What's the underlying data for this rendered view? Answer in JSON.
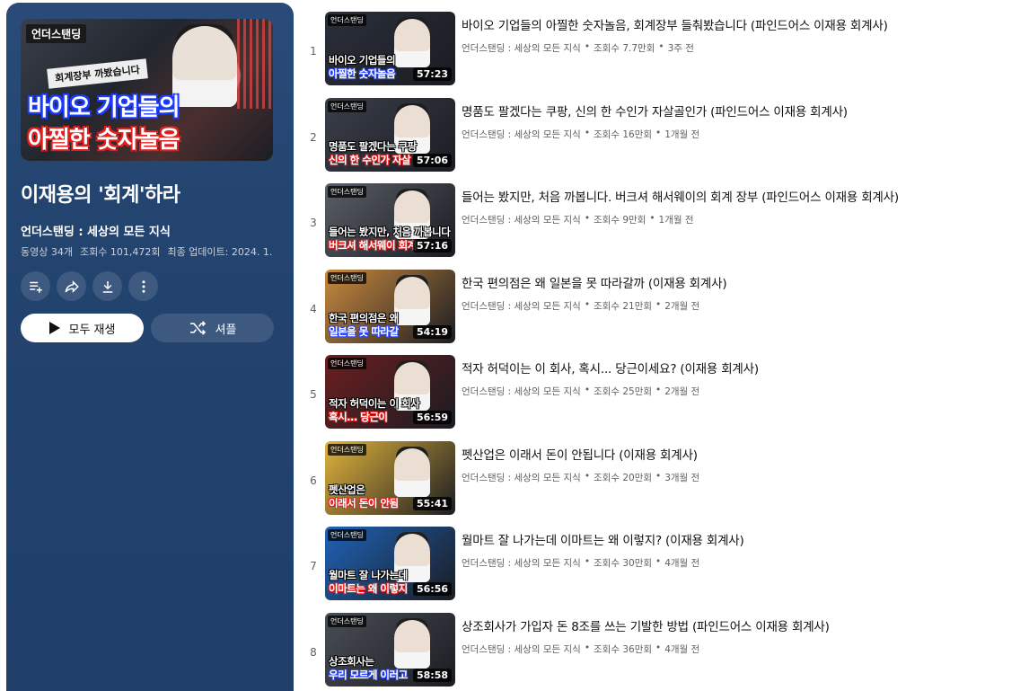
{
  "playlist": {
    "thumbnail": {
      "channel_tag": "언더스탠딩",
      "caption_small": "회계장부 까봤습니다",
      "caption_line1": "바이오 기업들의",
      "caption_line2": "아찔한 숫자놀음"
    },
    "title": "이재용의 '회계'하라",
    "channel": "언더스탠딩 : 세상의 모든 지식",
    "video_count": "동영상 34개",
    "view_count": "조회수 101,472회",
    "last_updated": "최종 업데이트: 2024. 1...",
    "icons": [
      "add-to-queue-icon",
      "share-icon",
      "download-icon",
      "more-icon"
    ],
    "play_all_label": "모두 재생",
    "shuffle_label": "셔플"
  },
  "videos": [
    {
      "index": "1",
      "title": "바이오 기업들의 아찔한 숫자놀음, 회계장부 들춰봤습니다 (파인드어스 이재용 회계사)",
      "channel": "언더스탠딩 : 세상의 모든 지식",
      "views": "조회수 7.7만회",
      "age": "3주 전",
      "duration": "57:23",
      "cap1": "바이오 기업들의",
      "cap2": "아찔한 숫자놀음",
      "bg": "#2b2f3a",
      "cap_color": "#2a45ff",
      "progress": 0.0
    },
    {
      "index": "2",
      "title": "명품도 팔겠다는 쿠팡, 신의 한 수인가 자살골인가 (파인드어스 이재용 회계사)",
      "channel": "언더스탠딩 : 세상의 모든 지식",
      "views": "조회수 16만회",
      "age": "1개월 전",
      "duration": "57:06",
      "cap1": "명품도 팔겠다는 쿠팡",
      "cap2": "신의 한 수인가 자살",
      "bg": "#3b3f4a",
      "cap_color": "#e01e1e",
      "progress": 0.0
    },
    {
      "index": "3",
      "title": "들어는 봤지만, 처음 까봅니다. 버크셔 해서웨이의 회계 장부 (파인드어스 이재용 회계사)",
      "channel": "언더스탠딩 : 세상의 모든 지식",
      "views": "조회수 9만회",
      "age": "1개월 전",
      "duration": "57:16",
      "cap1": "들어는 봤지만, 처음 까봅니다",
      "cap2": "버크셔 해서웨이 회계",
      "bg": "#5a5e66",
      "cap_color": "#e01e1e",
      "progress": 0.0
    },
    {
      "index": "4",
      "title": "한국 편의점은 왜 일본을 못 따라갈까 (이재용 회계사)",
      "channel": "언더스탠딩 : 세상의 모든 지식",
      "views": "조회수 21만회",
      "age": "2개월 전",
      "duration": "54:19",
      "cap1": "한국 편의점은 왜",
      "cap2": "일본을 못 따라갈",
      "bg": "#c98a3e",
      "cap_color": "#2a45ff",
      "progress": 0.0
    },
    {
      "index": "5",
      "title": "적자 허덕이는 이 회사, 혹시... 당근이세요? (이재용 회계사)",
      "channel": "언더스탠딩 : 세상의 모든 지식",
      "views": "조회수 25만회",
      "age": "2개월 전",
      "duration": "56:59",
      "cap1": "적자 허덕이는 이 회사",
      "cap2": "혹시... 당근이",
      "bg": "#6b1f1f",
      "cap_color": "#e01e1e",
      "progress": 0.0
    },
    {
      "index": "6",
      "title": "펫산업은 이래서 돈이 안됩니다 (이재용 회계사)",
      "channel": "언더스탠딩 : 세상의 모든 지식",
      "views": "조회수 20만회",
      "age": "3개월 전",
      "duration": "55:41",
      "cap1": "펫산업은",
      "cap2": "이래서 돈이 안됨",
      "bg": "#e2b43c",
      "cap_color": "#e01e1e",
      "progress": 0.0
    },
    {
      "index": "7",
      "title": "월마트 잘 나가는데 이마트는 왜 이렇지? (이재용 회계사)",
      "channel": "언더스탠딩 : 세상의 모든 지식",
      "views": "조회수 30만회",
      "age": "4개월 전",
      "duration": "56:56",
      "cap1": "월마트 잘 나가는데",
      "cap2": "이마트는 왜 이렇지",
      "bg": "#1f63b8",
      "cap_color": "#e01e1e",
      "progress": 0.0
    },
    {
      "index": "8",
      "title": "상조회사가 가입자 돈 8조를 쓰는 기발한 방법 (파인드어스 이재용 회계사)",
      "channel": "언더스탠딩 : 세상의 모든 지식",
      "views": "조회수 36만회",
      "age": "4개월 전",
      "duration": "58:58",
      "cap1": "상조회사는",
      "cap2": "우리 모르게 이러고",
      "bg": "#4a4f55",
      "cap_color": "#2a45ff",
      "progress": 0.0
    }
  ],
  "theme": {
    "panel_accent": "#244470",
    "progress_color": "#ff0000"
  }
}
